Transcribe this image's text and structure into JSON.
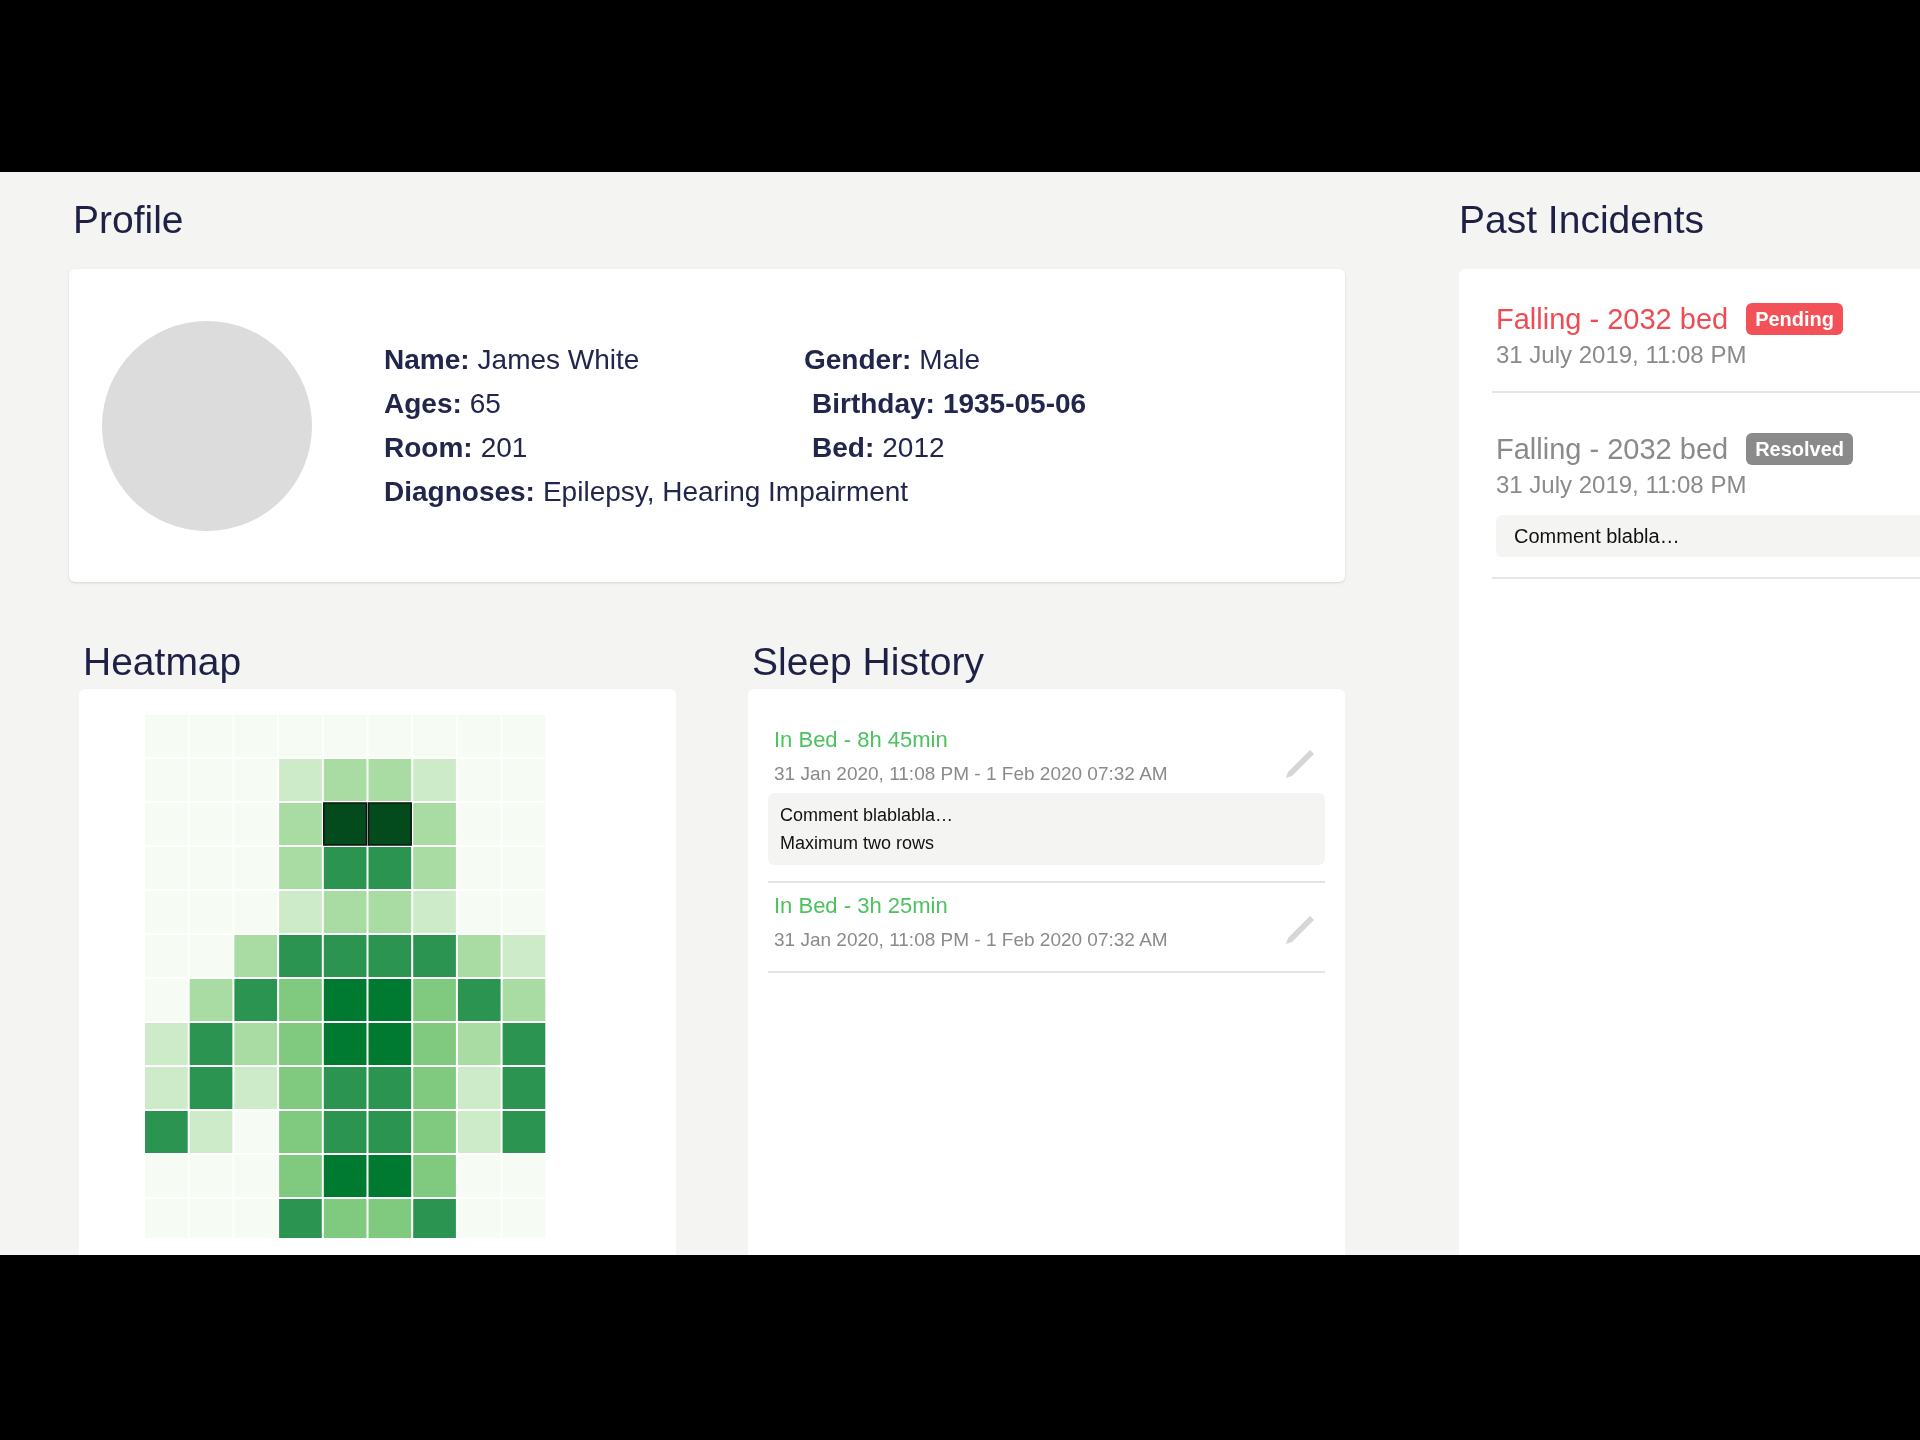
{
  "profile": {
    "title": "Profile",
    "fields": [
      {
        "label": "Name:",
        "value": "James White",
        "kind": "plain"
      },
      {
        "label": "Gender:",
        "value": "Male",
        "kind": "plain"
      },
      {
        "label": "Ages:",
        "value": "65",
        "kind": "plain"
      },
      {
        "label": "Birthday:",
        "value": "1935-05-06",
        "kind": "strong"
      },
      {
        "label": "Room:",
        "value": "201",
        "kind": "plain"
      },
      {
        "label": "Bed:",
        "value": "2012",
        "kind": "plain"
      },
      {
        "label": "Diagnoses:",
        "value": "Epilepsy, Hearing Impairment",
        "kind": "wide"
      }
    ]
  },
  "heatmap": {
    "title": "Heatmap"
  },
  "sleep_history": {
    "title": "Sleep History",
    "entries": [
      {
        "title": "In Bed - 8h 45min",
        "time": "31 Jan 2020, 11:08 PM - 1 Feb 2020 07:32 AM",
        "comment_lines": [
          "Comment blablabla…",
          "Maximum two rows"
        ]
      },
      {
        "title": "In Bed - 3h 25min",
        "time": "31 Jan 2020, 11:08 PM - 1 Feb 2020 07:32 AM"
      }
    ]
  },
  "past_incidents": {
    "title": "Past Incidents",
    "items": [
      {
        "title": "Falling - 2032 bed",
        "status": "Pending",
        "kind": "pending",
        "time": "31 July 2019, 11:08 PM"
      },
      {
        "title": "Falling - 2032 bed",
        "status": "Resolved",
        "kind": "resolved",
        "time": "31 July 2019, 11:08 PM",
        "comment": "Comment blabla…"
      }
    ]
  }
}
